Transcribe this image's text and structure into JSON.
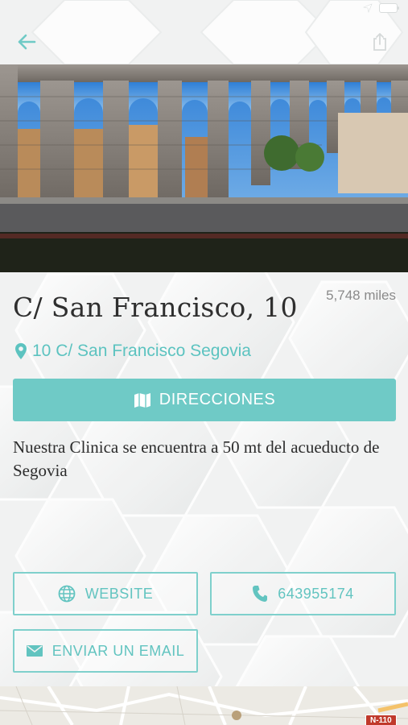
{
  "nav": {
    "back_icon": "arrow-left-icon",
    "share_icon": "share-icon"
  },
  "hero": {
    "image_desc": "aqueduct-photo"
  },
  "location": {
    "distance": "5,748 miles",
    "title": "C/ San Francisco, 10",
    "address": "10 C/ San Francisco Segovia",
    "description": "Nuestra Clinica se encuentra a 50 mt del acueducto de Segovia"
  },
  "actions": {
    "directions_label": "DIRECCIONES",
    "website_label": "WEBSITE",
    "phone_label": "643955174",
    "email_label": "ENVIAR UN EMAIL"
  },
  "map": {
    "road_label": "N-110"
  },
  "colors": {
    "accent": "#6fcac6",
    "accent_text": "#5cc3c0"
  }
}
